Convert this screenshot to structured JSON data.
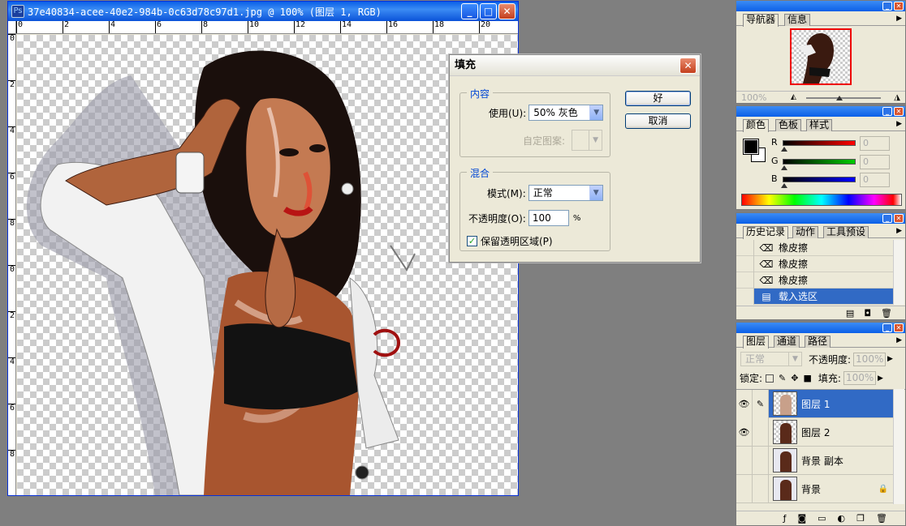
{
  "document": {
    "title": "37e40834-acee-40e2-984b-0c63d78c97d1.jpg @ 100% (图层 1, RGB)",
    "ruler_top": [
      "0",
      "2",
      "4",
      "6",
      "8",
      "10",
      "12",
      "14",
      "16",
      "18",
      "20"
    ],
    "ruler_left": [
      "0",
      "2",
      "4",
      "6",
      "8",
      "0",
      "2",
      "4",
      "6",
      "8"
    ]
  },
  "fill_dialog": {
    "title": "填充",
    "content_group": "内容",
    "use_label": "使用(U):",
    "use_value": "50% 灰色",
    "custom_pattern_label": "自定图案:",
    "blend_group": "混合",
    "mode_label": "模式(M):",
    "mode_value": "正常",
    "opacity_label": "不透明度(O):",
    "opacity_value": "100",
    "opacity_unit": "%",
    "preserve_label": "保留透明区域(P)",
    "ok": "好",
    "cancel": "取消"
  },
  "navigator": {
    "tabs": [
      "导航器",
      "信息"
    ],
    "zoom": "100%"
  },
  "color_panel": {
    "tabs": [
      "颜色",
      "色板",
      "样式"
    ],
    "channels": [
      {
        "label": "R",
        "value": "0"
      },
      {
        "label": "G",
        "value": "0"
      },
      {
        "label": "B",
        "value": "0"
      }
    ]
  },
  "history_panel": {
    "tabs": [
      "历史记录",
      "动作",
      "工具预设"
    ],
    "items": [
      {
        "label": "橡皮擦",
        "icon": "eraser-icon"
      },
      {
        "label": "橡皮擦",
        "icon": "eraser-icon"
      },
      {
        "label": "橡皮擦",
        "icon": "eraser-icon"
      },
      {
        "label": "载入选区",
        "icon": "load-selection-icon",
        "selected": true
      }
    ]
  },
  "layers_panel": {
    "tabs": [
      "图层",
      "通道",
      "路径"
    ],
    "blend_mode": "正常",
    "opacity_label": "不透明度:",
    "opacity_value": "100%",
    "lock_label": "锁定:",
    "fill_label": "填充:",
    "fill_value": "100%",
    "layers": [
      {
        "name": "图层 1",
        "visible": true,
        "selected": true
      },
      {
        "name": "图层 2",
        "visible": true,
        "selected": false
      },
      {
        "name": "背景 副本",
        "visible": false,
        "selected": false
      },
      {
        "name": "背景",
        "visible": false,
        "selected": false,
        "locked": true
      }
    ]
  },
  "colors": {
    "selection": "#316ac5",
    "titlebar": "#0a5fe8",
    "legend": "#0046d5"
  }
}
